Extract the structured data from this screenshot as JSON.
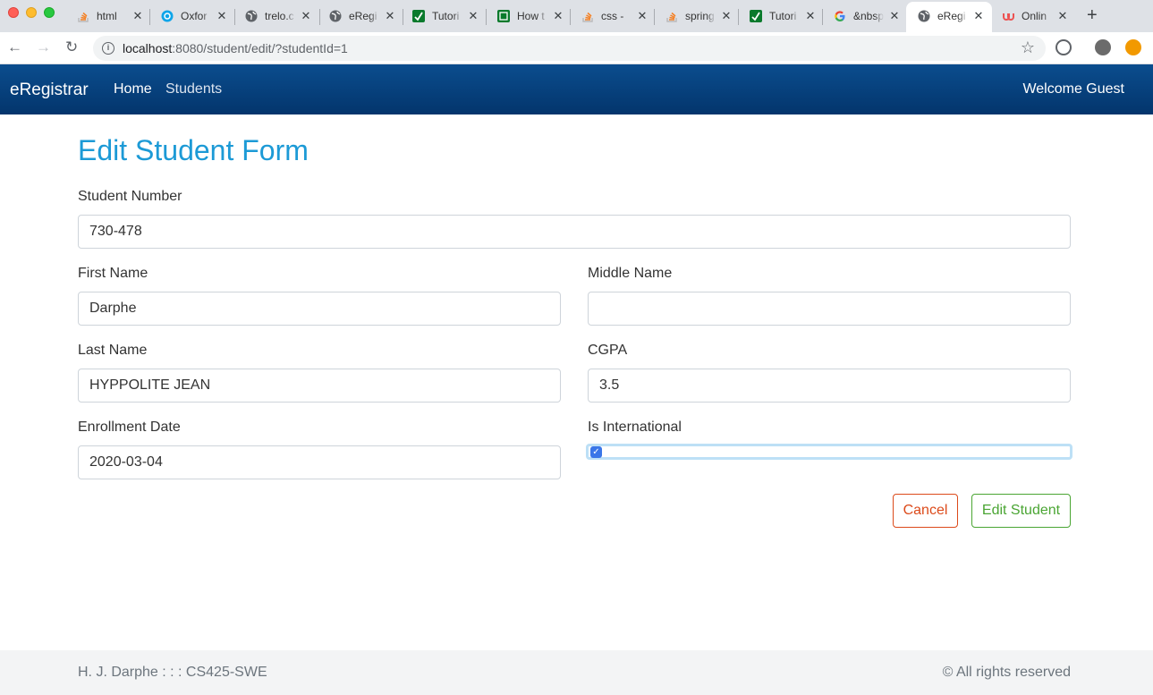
{
  "browser": {
    "tabs": [
      {
        "title": "html",
        "icon": "stackoverflow-icon"
      },
      {
        "title": "Oxfor",
        "icon": "globe-blue-icon"
      },
      {
        "title": "trelo.c",
        "icon": "globe-icon"
      },
      {
        "title": "eRegi",
        "icon": "globe-icon"
      },
      {
        "title": "Tutori",
        "icon": "green-check-icon"
      },
      {
        "title": "How t",
        "icon": "green-box-icon"
      },
      {
        "title": "css -",
        "icon": "stackoverflow-icon"
      },
      {
        "title": "spring",
        "icon": "stackoverflow-icon"
      },
      {
        "title": "Tutori",
        "icon": "green-check-icon"
      },
      {
        "title": "&nbsp",
        "icon": "google-icon"
      },
      {
        "title": "eRegi",
        "icon": "globe-icon",
        "active": true
      },
      {
        "title": "Onlin",
        "icon": "udemy-icon"
      }
    ],
    "url_host": "localhost",
    "url_path": ":8080/student/edit/?studentId=1"
  },
  "navbar": {
    "brand": "eRegistrar",
    "home": "Home",
    "students": "Students",
    "welcome": "Welcome Guest",
    "color": "#03356c"
  },
  "form": {
    "title": "Edit Student Form",
    "student_number": {
      "label": "Student Number",
      "value": "730-478"
    },
    "first_name": {
      "label": "First Name",
      "value": "Darphe"
    },
    "middle_name": {
      "label": "Middle Name",
      "value": ""
    },
    "last_name": {
      "label": "Last Name",
      "value": "HYPPOLITE JEAN"
    },
    "cgpa": {
      "label": "CGPA",
      "value": "3.5"
    },
    "enrollment_date": {
      "label": "Enrollment Date",
      "value": "2020-03-04"
    },
    "is_international": {
      "label": "Is International",
      "checked": true
    },
    "cancel_label": "Cancel",
    "submit_label": "Edit Student"
  },
  "footer": {
    "left": "H. J. Darphe : : : CS425-SWE",
    "right": "© All rights reserved"
  }
}
